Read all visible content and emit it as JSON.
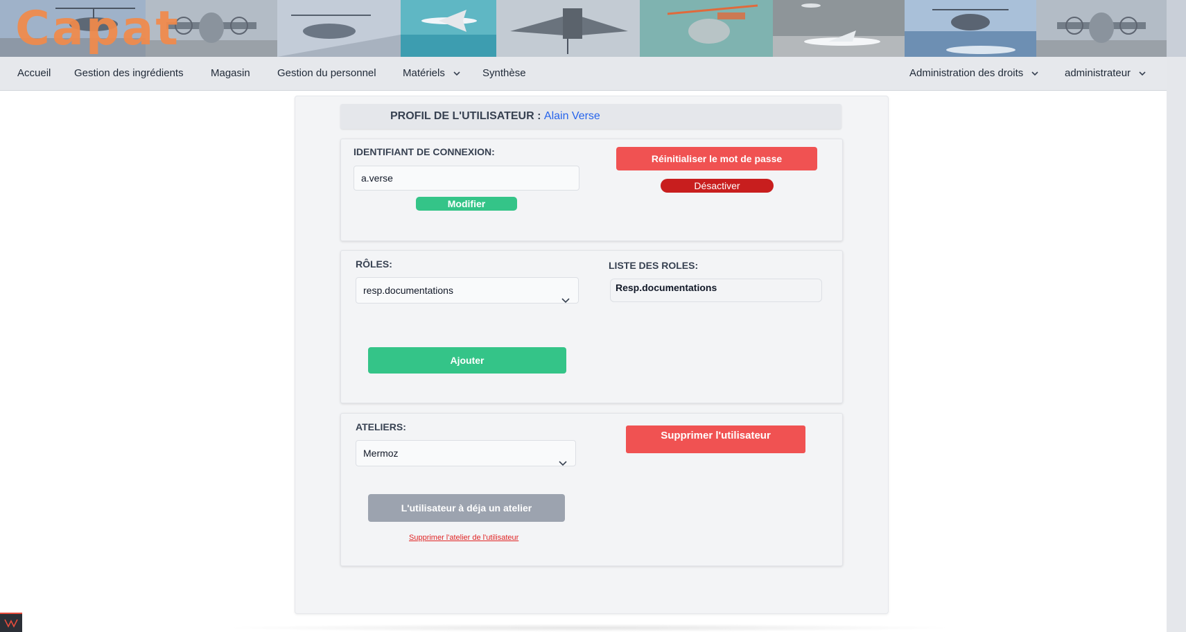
{
  "app": {
    "logo_text": "Capat"
  },
  "banner": {
    "images": [
      "helicopter",
      "turboprop-aircraft",
      "helicopter-carrier",
      "business-jet-over-sea",
      "fighter-jet",
      "rescue-helicopter",
      "business-jet-on-runway",
      "helicopter-over-sea",
      "turboprop-aircraft"
    ]
  },
  "nav": {
    "left": [
      {
        "label": "Accueil",
        "dropdown": false
      },
      {
        "label": "Gestion des ingrédients",
        "dropdown": false
      },
      {
        "label": "Magasin",
        "dropdown": false
      },
      {
        "label": "Gestion du personnel",
        "dropdown": false
      },
      {
        "label": "Matériels",
        "dropdown": true,
        "icon": "chevron-down-icon"
      },
      {
        "label": "Synthèse",
        "dropdown": false
      }
    ],
    "right": [
      {
        "label": "Administration des droits",
        "dropdown": true,
        "icon": "chevron-down-icon"
      },
      {
        "label": "administrateur",
        "dropdown": true,
        "icon": "chevron-down-icon"
      }
    ]
  },
  "profile": {
    "title": "PROFIL DE L'UTILISATEUR :",
    "user_name": "Alain Verse"
  },
  "login": {
    "label": "IDENTIFIANT DE CONNEXION:",
    "value": "a.verse",
    "modify_button": "Modifier",
    "reset_password_button": "Réinitialiser le mot de passe",
    "deactivate_button": "Désactiver"
  },
  "roles": {
    "label": "RÔLES:",
    "selected": "resp.documentations",
    "list_label": "LISTE DES ROLES:",
    "list_items": [
      "Resp.documentations"
    ],
    "add_button": "Ajouter"
  },
  "workshops": {
    "label": "ATELIERS:",
    "selected": "Mermoz",
    "disabled_button": "L'utilisateur à déja un atelier",
    "remove_workshop_link": "Supprimer l'atelier de l'utilisateur",
    "delete_user_button": "Supprimer l'utilisateur"
  },
  "colors": {
    "accent_blue": "#2563eb",
    "green": "#34c488",
    "red": "#f05252",
    "dark_red": "#c81e1e",
    "gray": "#9ca3af",
    "logo_orange": "#f28a4a"
  }
}
